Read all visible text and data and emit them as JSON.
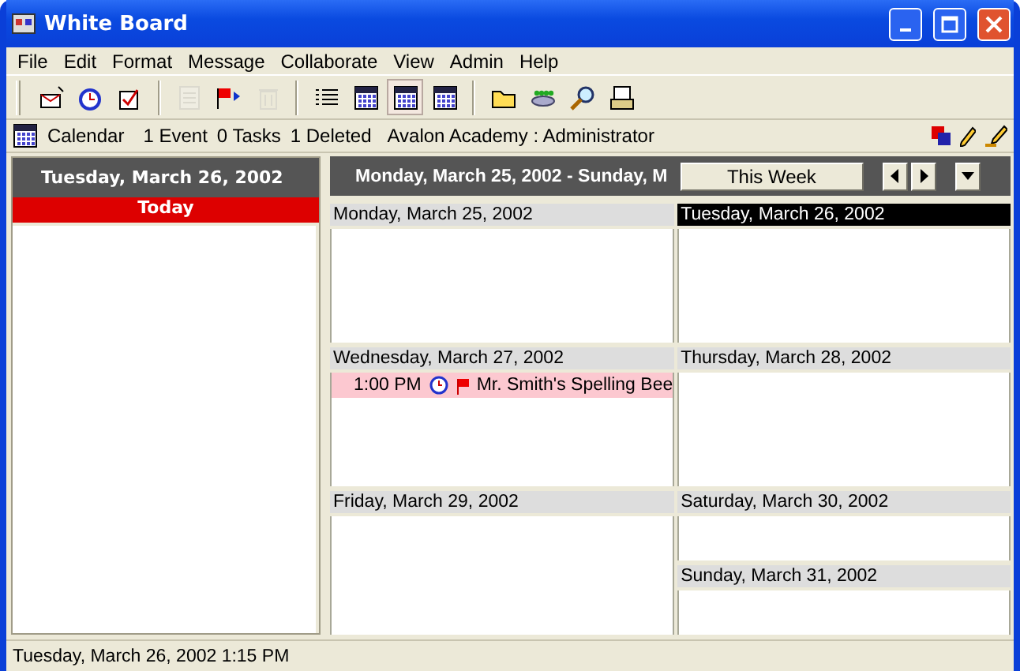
{
  "window": {
    "title": "White Board"
  },
  "menu": [
    "File",
    "Edit",
    "Format",
    "Message",
    "Collaborate",
    "View",
    "Admin",
    "Help"
  ],
  "toolbar": [
    [
      {
        "kind": "new-message",
        "disabled": false,
        "selected": false
      },
      {
        "kind": "new-event",
        "disabled": false,
        "selected": false
      },
      {
        "kind": "new-task",
        "disabled": false,
        "selected": false
      }
    ],
    [
      {
        "kind": "print",
        "disabled": true,
        "selected": false
      },
      {
        "kind": "flag",
        "disabled": false,
        "selected": false
      },
      {
        "kind": "trash",
        "disabled": true,
        "selected": false
      }
    ],
    [
      {
        "kind": "list",
        "disabled": false,
        "selected": false
      },
      {
        "kind": "calendar",
        "disabled": false,
        "selected": false
      },
      {
        "kind": "calendar",
        "disabled": false,
        "selected": true
      },
      {
        "kind": "calendar",
        "disabled": false,
        "selected": false
      }
    ],
    [
      {
        "kind": "folder",
        "disabled": false,
        "selected": false
      },
      {
        "kind": "people",
        "disabled": false,
        "selected": false
      },
      {
        "kind": "search",
        "disabled": false,
        "selected": false
      },
      {
        "kind": "printer",
        "disabled": false,
        "selected": false
      }
    ]
  ],
  "info_bar": {
    "module": "Calendar",
    "counts": [
      "1 Event",
      "0 Tasks",
      "1 Deleted"
    ],
    "account": "Avalon Academy : Administrator"
  },
  "day_panel": {
    "date": "Tuesday, March 26, 2002",
    "label": "Today"
  },
  "week_panel": {
    "range": "Monday, March 25, 2002 - Sunday, M",
    "button": "This Week",
    "days": [
      {
        "date": "Monday, March 25, 2002",
        "selected": false
      },
      {
        "date": "Tuesday, March 26, 2002",
        "selected": true
      },
      {
        "date": "Wednesday, March 27, 2002",
        "selected": false,
        "events": [
          {
            "time": "1:00 PM",
            "title": "Mr. Smith's Spelling Bee"
          }
        ]
      },
      {
        "date": "Thursday, March 28, 2002",
        "selected": false
      },
      {
        "date": "Friday, March 29, 2002",
        "selected": false
      },
      {
        "date": "Saturday, March 30, 2002",
        "selected": false
      },
      {
        "date": "Sunday, March 31, 2002",
        "selected": false
      }
    ]
  },
  "status_bar": "Tuesday, March 26, 2002 1:15 PM"
}
